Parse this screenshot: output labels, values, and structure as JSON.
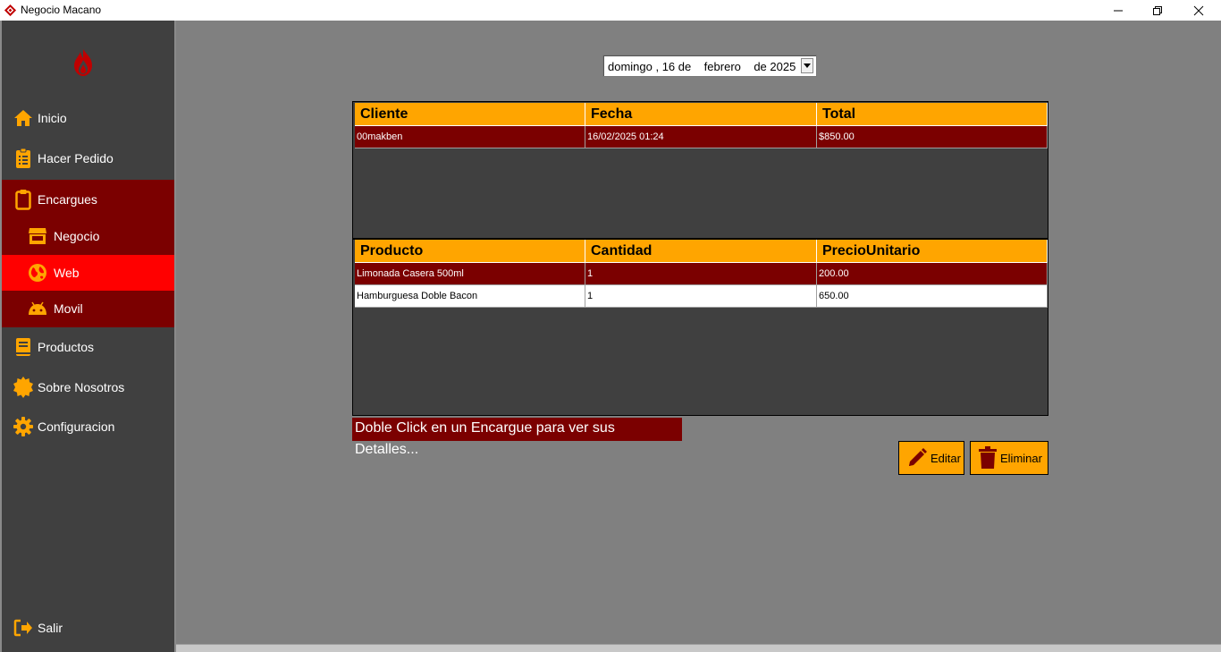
{
  "window": {
    "title": "Negocio Macano"
  },
  "colors": {
    "accent": "#ffa500",
    "dark_red": "#7b0000",
    "active_red": "#ff0000",
    "sidebar_bg": "#404040",
    "main_bg": "#808080"
  },
  "sidebar": {
    "items": [
      {
        "label": "Inicio",
        "icon": "home-icon"
      },
      {
        "label": "Hacer Pedido",
        "icon": "clipboard-list-icon"
      },
      {
        "label": "Encargues",
        "icon": "clipboard-icon"
      },
      {
        "label": "Negocio",
        "icon": "store-icon"
      },
      {
        "label": "Web",
        "icon": "globe-icon"
      },
      {
        "label": "Movil",
        "icon": "android-icon"
      },
      {
        "label": "Productos",
        "icon": "book-icon"
      },
      {
        "label": "Sobre Nosotros",
        "icon": "badge-icon"
      },
      {
        "label": "Configuracion",
        "icon": "gear-icon"
      },
      {
        "label": "Salir",
        "icon": "logout-icon"
      }
    ],
    "active": "Web"
  },
  "date_picker": {
    "value": "domingo , 16 de    febrero    de 2025"
  },
  "orders_table": {
    "headers": [
      "Cliente",
      "Fecha",
      "Total"
    ],
    "rows": [
      [
        "00makben",
        "16/02/2025 01:24",
        "$850.00"
      ]
    ]
  },
  "details_table": {
    "headers": [
      "Producto",
      "Cantidad",
      "PrecioUnitario"
    ],
    "rows": [
      [
        "Limonada Casera 500ml",
        "1",
        "200.00"
      ],
      [
        "Hamburguesa Doble Bacon",
        "1",
        "650.00"
      ]
    ]
  },
  "hint": "Doble Click en un Encargue para ver sus Detalles...",
  "actions": {
    "edit_label": "Editar",
    "delete_label": "Eliminar"
  }
}
